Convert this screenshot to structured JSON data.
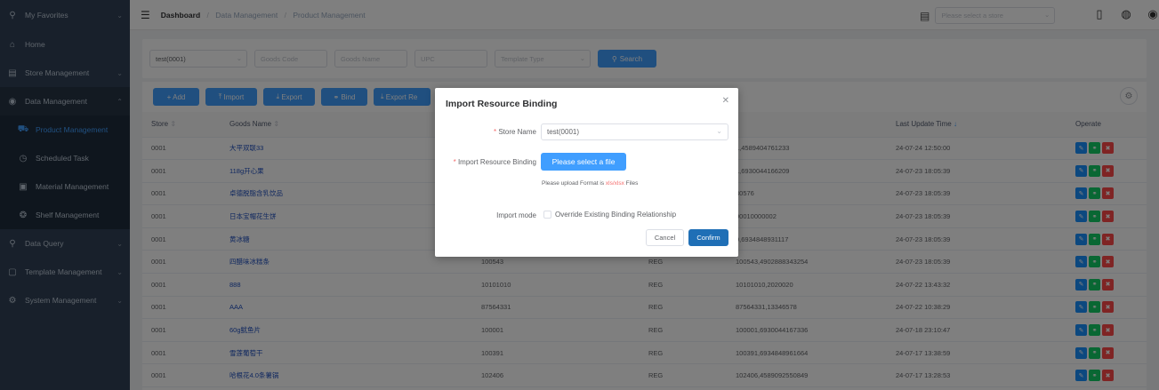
{
  "sidebar": {
    "items": [
      {
        "label": "My Favorites",
        "icon": "search-icon",
        "chev": "⌄"
      },
      {
        "label": "Home",
        "icon": "home-icon"
      },
      {
        "label": "Store Management",
        "icon": "store-icon",
        "chev": "⌄"
      },
      {
        "label": "Data Management",
        "icon": "data-icon",
        "chev": "⌃"
      },
      {
        "label": "Product Management",
        "icon": "cart-icon"
      },
      {
        "label": "Scheduled Task",
        "icon": "clock-icon"
      },
      {
        "label": "Material Management",
        "icon": "image-icon"
      },
      {
        "label": "Shelf Management",
        "icon": "shelf-icon"
      },
      {
        "label": "Data Query",
        "icon": "query-icon",
        "chev": "⌄"
      },
      {
        "label": "Template Management",
        "icon": "template-icon",
        "chev": "⌄"
      },
      {
        "label": "System Management",
        "icon": "gear-icon",
        "chev": "⌄"
      }
    ]
  },
  "header": {
    "breadcrumb": [
      "Dashboard",
      "Data Management",
      "Product Management"
    ],
    "store_placeholder": "Please select a store"
  },
  "filter": {
    "store_value": "test(0001)",
    "goods_code": "Goods Code",
    "goods_name": "Goods Name",
    "upc": "UPC",
    "template_type": "Template Type",
    "search_label": "Search"
  },
  "toolbar": {
    "add": "+ Add",
    "import": "Import",
    "export": "Export",
    "bind": "Bind",
    "export_res": "Export Re"
  },
  "table": {
    "headers": {
      "store": "Store",
      "goods_name": "Goods Name",
      "last_update": "Last Update Time"
    },
    "operate": "Operate",
    "rows": [
      {
        "store": "0001",
        "name": "大平双联33",
        "code": "",
        "type": "",
        "bind": "1,4589404761233",
        "time": "24-07-24 12:50:00"
      },
      {
        "store": "0001",
        "name": "118g开心果",
        "code": "",
        "type": "",
        "bind": "1,6930044166209",
        "time": "24-07-23 18:05:39"
      },
      {
        "store": "0001",
        "name": "卓德脱脂含乳饮品",
        "code": "",
        "type": "",
        "bind": "30576",
        "time": "24-07-23 18:05:39"
      },
      {
        "store": "0001",
        "name": "日本宝帽花生饼",
        "code": "",
        "type": "",
        "bind": "00010000002",
        "time": "24-07-23 18:05:39"
      },
      {
        "store": "0001",
        "name": "黄冰糖",
        "code": "",
        "type": "",
        "bind": "9,6934848931117",
        "time": "24-07-23 18:05:39"
      },
      {
        "store": "0001",
        "name": "四醋味冰糕条",
        "code": "100543",
        "type": "REG",
        "bind": "100543,4902888343254",
        "time": "24-07-23 18:05:39"
      },
      {
        "store": "0001",
        "name": "888",
        "code": "10101010",
        "type": "REG",
        "bind": "10101010,2020020",
        "time": "24-07-22 13:43:32"
      },
      {
        "store": "0001",
        "name": "AAA",
        "code": "87564331",
        "type": "REG",
        "bind": "87564331,13346578",
        "time": "24-07-22 10:38:29"
      },
      {
        "store": "0001",
        "name": "60g鱿鱼片",
        "code": "100001",
        "type": "REG",
        "bind": "100001,6930044167336",
        "time": "24-07-18 23:10:47"
      },
      {
        "store": "0001",
        "name": "雪莲葡萄干",
        "code": "100391",
        "type": "REG",
        "bind": "100391,6934848961664",
        "time": "24-07-17 13:38:59"
      },
      {
        "store": "0001",
        "name": "哈根花4.0条薯锅",
        "code": "102406",
        "type": "REG",
        "bind": "102406,4589092550849",
        "time": "24-07-17 13:28:53"
      }
    ]
  },
  "dialog": {
    "title": "Import Resource Binding",
    "store_label": "Store Name",
    "store_value": "test(0001)",
    "import_label": "Import Resource Binding",
    "file_button": "Please select a file",
    "tip_prefix": "Please upload Format is ",
    "tip_format": "xls/xlsx",
    "tip_suffix": " Files",
    "mode_label": "Import mode",
    "override_label": "Override Existing Binding Relationship",
    "cancel": "Cancel",
    "confirm": "Confirm"
  }
}
